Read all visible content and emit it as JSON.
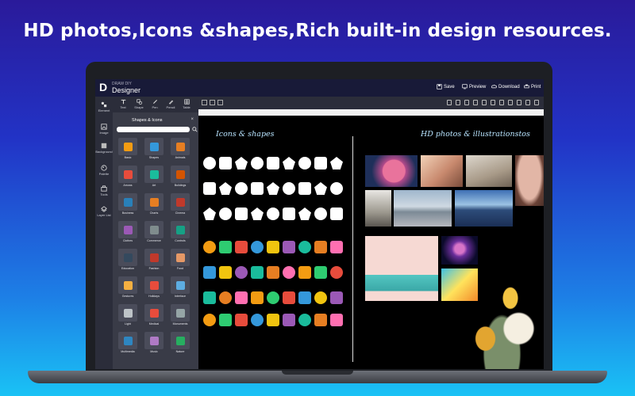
{
  "headline": "HD photos,Icons &shapes,Rich built-in design resources.",
  "app": {
    "logo_small": "DRAW DIY",
    "logo_text": "Designer",
    "actions": [
      {
        "label": "Save",
        "icon": "save-icon"
      },
      {
        "label": "Preview",
        "icon": "monitor-icon"
      },
      {
        "label": "Download",
        "icon": "cloud-download-icon"
      },
      {
        "label": "Print",
        "icon": "printer-icon"
      }
    ]
  },
  "rail": [
    {
      "label": "Element",
      "icon": "element-icon"
    },
    {
      "label": "Image",
      "icon": "image-icon"
    },
    {
      "label": "Background",
      "icon": "background-icon"
    },
    {
      "label": "Palette",
      "icon": "palette-icon"
    },
    {
      "label": "Tools",
      "icon": "toolbox-icon"
    },
    {
      "label": "Layer List",
      "icon": "layers-icon"
    }
  ],
  "tools": [
    {
      "label": "Text",
      "icon": "text-icon"
    },
    {
      "label": "Shape",
      "icon": "shape-icon"
    },
    {
      "label": "Pen",
      "icon": "pen-icon"
    },
    {
      "label": "Pencil",
      "icon": "pencil-icon"
    },
    {
      "label": "Table",
      "icon": "table-icon"
    }
  ],
  "panel": {
    "title": "Shapes & Icons",
    "close": "×",
    "categories": [
      {
        "label": "Basic",
        "color": "#f39c12"
      },
      {
        "label": "Shapes",
        "color": "#3498db"
      },
      {
        "label": "Animals",
        "color": "#e67e22"
      },
      {
        "label": "Arrows",
        "color": "#e74c3c"
      },
      {
        "label": "Art",
        "color": "#1abc9c"
      },
      {
        "label": "Buildings",
        "color": "#d35400"
      },
      {
        "label": "Business",
        "color": "#2980b9"
      },
      {
        "label": "Charts",
        "color": "#e67e22"
      },
      {
        "label": "Cinema",
        "color": "#c0392b"
      },
      {
        "label": "Clothes",
        "color": "#9b59b6"
      },
      {
        "label": "Commerce",
        "color": "#7f8c8d"
      },
      {
        "label": "Controls",
        "color": "#16a085"
      },
      {
        "label": "Education",
        "color": "#34495e"
      },
      {
        "label": "Fashion",
        "color": "#c0392b"
      },
      {
        "label": "Food",
        "color": "#e59866"
      },
      {
        "label": "Gestures",
        "color": "#f5b041"
      },
      {
        "label": "Holidays",
        "color": "#e74c3c"
      },
      {
        "label": "Interface",
        "color": "#5dade2"
      },
      {
        "label": "Light",
        "color": "#bdc3c7"
      },
      {
        "label": "Medical",
        "color": "#e74c3c"
      },
      {
        "label": "Monuments",
        "color": "#95a5a6"
      },
      {
        "label": "Multimedia",
        "color": "#2e86c1"
      },
      {
        "label": "Music",
        "color": "#af7ac5"
      },
      {
        "label": "Nature",
        "color": "#27ae60"
      }
    ]
  },
  "canvas": {
    "left_title": "Icons & shapes",
    "right_title": "HD photos & illustrationstos"
  }
}
